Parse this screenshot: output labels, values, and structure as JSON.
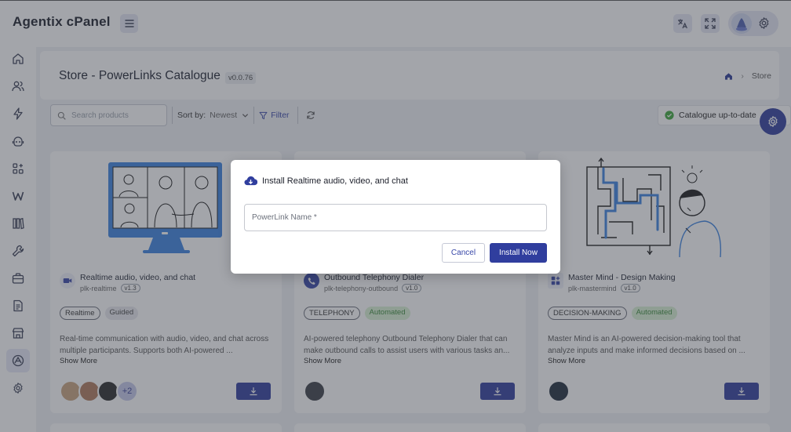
{
  "app": {
    "brand": "Agentix cPanel"
  },
  "header": {
    "title": "Store - PowerLinks Catalogue",
    "version": "v0.0.76",
    "breadcrumb_current": "Store"
  },
  "toolbar": {
    "search_placeholder": "Search products",
    "sort_label": "Sort by:",
    "sort_value": "Newest",
    "filter_label": "Filter",
    "status": "Catalogue up-to-date"
  },
  "cards": [
    {
      "title": "Realtime audio, video, and chat",
      "slug": "plk-realtime",
      "version": "v1.3",
      "tags": [
        "Realtime",
        "Guided"
      ],
      "description": "Real-time communication with audio, video, and chat across multiple participants. Supports both AI-powered ...",
      "show_more": "Show More",
      "extra_count": "+2"
    },
    {
      "title": "Outbound Telephony Dialer",
      "slug": "plk-telephony-outbound",
      "version": "v1.0",
      "tags": [
        "TELEPHONY",
        "Automated"
      ],
      "description": "AI-powered telephony Outbound Telephony Dialer that can make outbound calls to assist users with various tasks an...",
      "show_more": "Show More"
    },
    {
      "title": "Master Mind - Design Making",
      "slug": "plk-mastermind",
      "version": "v1.0",
      "tags": [
        "DECISION-MAKING",
        "Automated"
      ],
      "description": "Master Mind is an AI-powered decision-making tool that analyze inputs and make informed decisions based on ...",
      "show_more": "Show More"
    }
  ],
  "modal": {
    "title": "Install Realtime audio, video, and chat",
    "input_placeholder": "PowerLink Name *",
    "input_value": "",
    "cancel_label": "Cancel",
    "install_label": "Install Now"
  },
  "colors": {
    "primary": "#303e9e",
    "success": "#3a8b3a",
    "overlay": "rgba(60,64,74,0.47)"
  }
}
